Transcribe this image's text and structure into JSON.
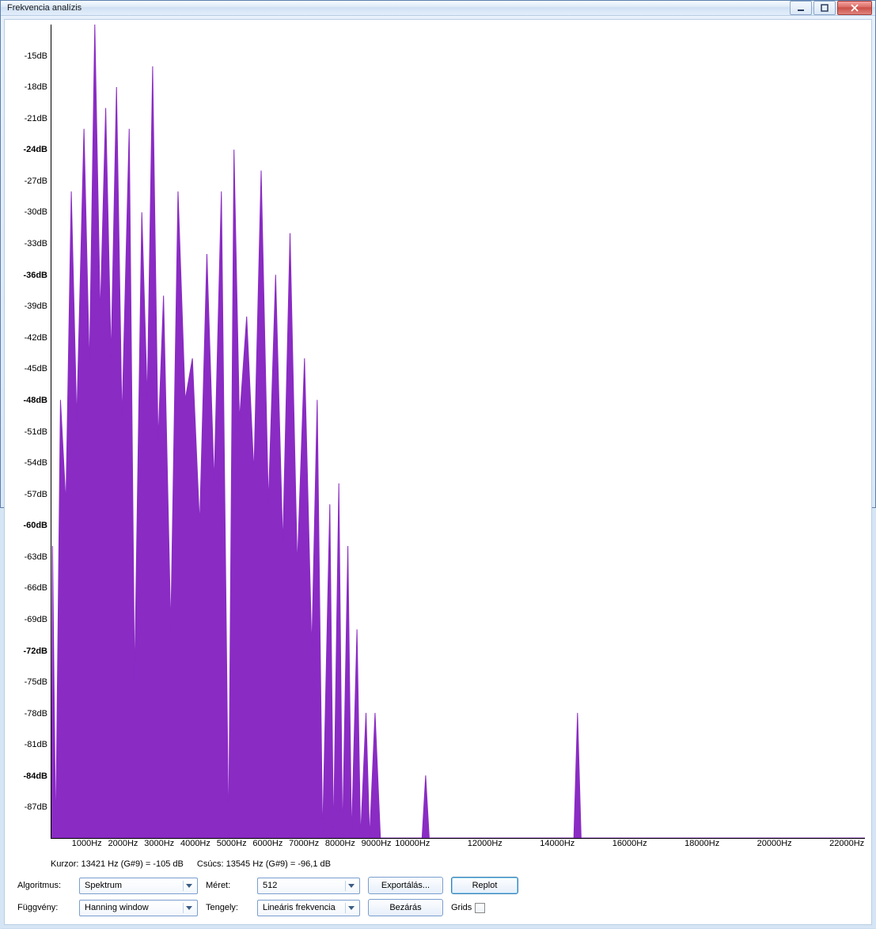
{
  "window": {
    "title": "Frekvencia analízis"
  },
  "status": {
    "cursor": "Kurzor: 13421 Hz (G#9) = -105 dB",
    "peak": "Csúcs: 13545 Hz (G#9) = -96,1 dB"
  },
  "controls": {
    "algorithm_label": "Algoritmus:",
    "algorithm_value": "Spektrum",
    "size_label": "Méret:",
    "size_value": "512",
    "function_label": "Függvény:",
    "function_value": "Hanning window",
    "axis_label": "Tengely:",
    "axis_value": "Lineáris frekvencia",
    "export": "Exportálás...",
    "close": "Bezárás",
    "replot": "Replot",
    "grids": "Grids"
  },
  "chart_data": {
    "type": "area",
    "title": "",
    "xlabel": "",
    "ylabel": "",
    "xlim": [
      0,
      22500
    ],
    "ylim": [
      -90,
      -12
    ],
    "y_ticks": [
      {
        "v": -15,
        "l": "-15dB"
      },
      {
        "v": -18,
        "l": "-18dB"
      },
      {
        "v": -21,
        "l": "-21dB"
      },
      {
        "v": -24,
        "l": "-24dB",
        "bold": true
      },
      {
        "v": -27,
        "l": "-27dB"
      },
      {
        "v": -30,
        "l": "-30dB"
      },
      {
        "v": -33,
        "l": "-33dB"
      },
      {
        "v": -36,
        "l": "-36dB",
        "bold": true
      },
      {
        "v": -39,
        "l": "-39dB"
      },
      {
        "v": -42,
        "l": "-42dB"
      },
      {
        "v": -45,
        "l": "-45dB"
      },
      {
        "v": -48,
        "l": "-48dB",
        "bold": true
      },
      {
        "v": -51,
        "l": "-51dB"
      },
      {
        "v": -54,
        "l": "-54dB"
      },
      {
        "v": -57,
        "l": "-57dB"
      },
      {
        "v": -60,
        "l": "-60dB",
        "bold": true
      },
      {
        "v": -63,
        "l": "-63dB"
      },
      {
        "v": -66,
        "l": "-66dB"
      },
      {
        "v": -69,
        "l": "-69dB"
      },
      {
        "v": -72,
        "l": "-72dB",
        "bold": true
      },
      {
        "v": -75,
        "l": "-75dB"
      },
      {
        "v": -78,
        "l": "-78dB"
      },
      {
        "v": -81,
        "l": "-81dB"
      },
      {
        "v": -84,
        "l": "-84dB",
        "bold": true
      },
      {
        "v": -87,
        "l": "-87dB"
      }
    ],
    "x_ticks": [
      {
        "v": 1000,
        "l": "1000Hz"
      },
      {
        "v": 2000,
        "l": "2000Hz"
      },
      {
        "v": 3000,
        "l": "3000Hz"
      },
      {
        "v": 4000,
        "l": "4000Hz"
      },
      {
        "v": 5000,
        "l": "5000Hz"
      },
      {
        "v": 6000,
        "l": "6000Hz"
      },
      {
        "v": 7000,
        "l": "7000Hz"
      },
      {
        "v": 8000,
        "l": "8000Hz"
      },
      {
        "v": 9000,
        "l": "9000Hz"
      },
      {
        "v": 10000,
        "l": "10000Hz"
      },
      {
        "v": 12000,
        "l": "12000Hz"
      },
      {
        "v": 14000,
        "l": "14000Hz"
      },
      {
        "v": 16000,
        "l": "16000Hz"
      },
      {
        "v": 18000,
        "l": "18000Hz"
      },
      {
        "v": 20000,
        "l": "20000Hz"
      },
      {
        "v": 22000,
        "l": "22000Hz"
      }
    ],
    "series": [
      {
        "name": "spectrum",
        "color": "#8a2bc4",
        "points": [
          {
            "x": 30,
            "y": -62
          },
          {
            "x": 120,
            "y": -90
          },
          {
            "x": 250,
            "y": -48
          },
          {
            "x": 400,
            "y": -58
          },
          {
            "x": 550,
            "y": -28
          },
          {
            "x": 700,
            "y": -50
          },
          {
            "x": 900,
            "y": -22
          },
          {
            "x": 1050,
            "y": -45
          },
          {
            "x": 1200,
            "y": -12
          },
          {
            "x": 1350,
            "y": -40
          },
          {
            "x": 1500,
            "y": -20
          },
          {
            "x": 1650,
            "y": -44
          },
          {
            "x": 1800,
            "y": -18
          },
          {
            "x": 1950,
            "y": -50
          },
          {
            "x": 2150,
            "y": -22
          },
          {
            "x": 2300,
            "y": -75
          },
          {
            "x": 2500,
            "y": -30
          },
          {
            "x": 2650,
            "y": -48
          },
          {
            "x": 2800,
            "y": -16
          },
          {
            "x": 2950,
            "y": -52
          },
          {
            "x": 3100,
            "y": -38
          },
          {
            "x": 3300,
            "y": -70
          },
          {
            "x": 3500,
            "y": -28
          },
          {
            "x": 3700,
            "y": -48
          },
          {
            "x": 3900,
            "y": -44
          },
          {
            "x": 4100,
            "y": -60
          },
          {
            "x": 4300,
            "y": -34
          },
          {
            "x": 4500,
            "y": -56
          },
          {
            "x": 4700,
            "y": -28
          },
          {
            "x": 4900,
            "y": -90
          },
          {
            "x": 5050,
            "y": -24
          },
          {
            "x": 5200,
            "y": -50
          },
          {
            "x": 5400,
            "y": -40
          },
          {
            "x": 5600,
            "y": -55
          },
          {
            "x": 5800,
            "y": -26
          },
          {
            "x": 6000,
            "y": -58
          },
          {
            "x": 6200,
            "y": -36
          },
          {
            "x": 6400,
            "y": -62
          },
          {
            "x": 6600,
            "y": -32
          },
          {
            "x": 6800,
            "y": -64
          },
          {
            "x": 7000,
            "y": -44
          },
          {
            "x": 7200,
            "y": -72
          },
          {
            "x": 7350,
            "y": -48
          },
          {
            "x": 7500,
            "y": -90
          },
          {
            "x": 7700,
            "y": -58
          },
          {
            "x": 7800,
            "y": -90
          },
          {
            "x": 7950,
            "y": -56
          },
          {
            "x": 8050,
            "y": -90
          },
          {
            "x": 8200,
            "y": -62
          },
          {
            "x": 8300,
            "y": -90
          },
          {
            "x": 8450,
            "y": -70
          },
          {
            "x": 8550,
            "y": -90
          },
          {
            "x": 8700,
            "y": -78
          },
          {
            "x": 8800,
            "y": -90
          },
          {
            "x": 8950,
            "y": -78
          },
          {
            "x": 9100,
            "y": -90
          },
          {
            "x": 10250,
            "y": -90
          },
          {
            "x": 10350,
            "y": -84
          },
          {
            "x": 10450,
            "y": -90
          },
          {
            "x": 14450,
            "y": -90
          },
          {
            "x": 14550,
            "y": -78
          },
          {
            "x": 14650,
            "y": -90
          },
          {
            "x": 22500,
            "y": -90
          }
        ]
      }
    ]
  }
}
